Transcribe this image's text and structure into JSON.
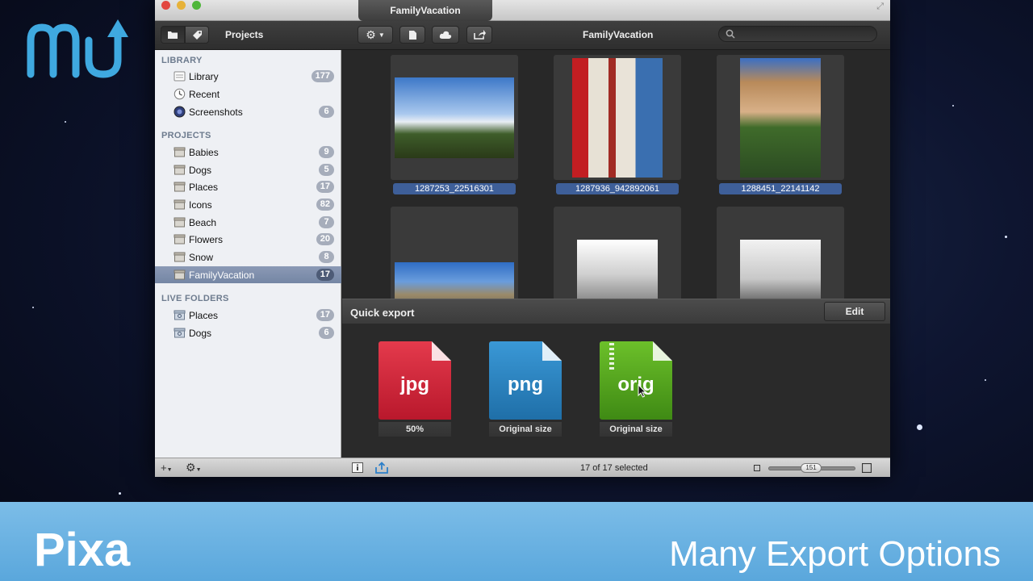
{
  "window": {
    "title": "FamilyVacation"
  },
  "toolbar": {
    "projects_label": "Projects",
    "title": "FamilyVacation",
    "search_placeholder": ""
  },
  "sidebar": {
    "library_heading": "LIBRARY",
    "library_items": [
      {
        "label": "Library",
        "count": "177",
        "icon": "library-icon"
      },
      {
        "label": "Recent",
        "count": "",
        "icon": "clock-icon"
      },
      {
        "label": "Screenshots",
        "count": "6",
        "icon": "screenshots-icon"
      }
    ],
    "projects_heading": "PROJECTS",
    "project_items": [
      {
        "label": "Babies",
        "count": "9"
      },
      {
        "label": "Dogs",
        "count": "5"
      },
      {
        "label": "Places",
        "count": "17"
      },
      {
        "label": "Icons",
        "count": "82"
      },
      {
        "label": "Beach",
        "count": "7"
      },
      {
        "label": "Flowers",
        "count": "20"
      },
      {
        "label": "Snow",
        "count": "8"
      },
      {
        "label": "FamilyVacation",
        "count": "17",
        "selected": true
      }
    ],
    "live_heading": "LIVE FOLDERS",
    "live_items": [
      {
        "label": "Places",
        "count": "17"
      },
      {
        "label": "Dogs",
        "count": "6"
      }
    ]
  },
  "grid": {
    "captions": [
      "1287253_22516301",
      "1287936_942892061",
      "1288451_22141142"
    ]
  },
  "quick_export": {
    "title": "Quick export",
    "edit_label": "Edit",
    "items": [
      {
        "ext": "jpg",
        "sub": "50%",
        "color": "#d8203a"
      },
      {
        "ext": "png",
        "sub": "Original size",
        "color": "#2e87c4"
      },
      {
        "ext": "orig",
        "sub": "Original size",
        "color": "#5cac1e"
      }
    ]
  },
  "statusbar": {
    "status_text": "17 of 17 selected",
    "zoom_value": "151"
  },
  "banner": {
    "app_name": "Pixa",
    "tagline": "Many Export Options"
  },
  "colors": {
    "selection": "#7486a4",
    "badge": "#a6adbb",
    "banner": "#6bb3e2"
  }
}
